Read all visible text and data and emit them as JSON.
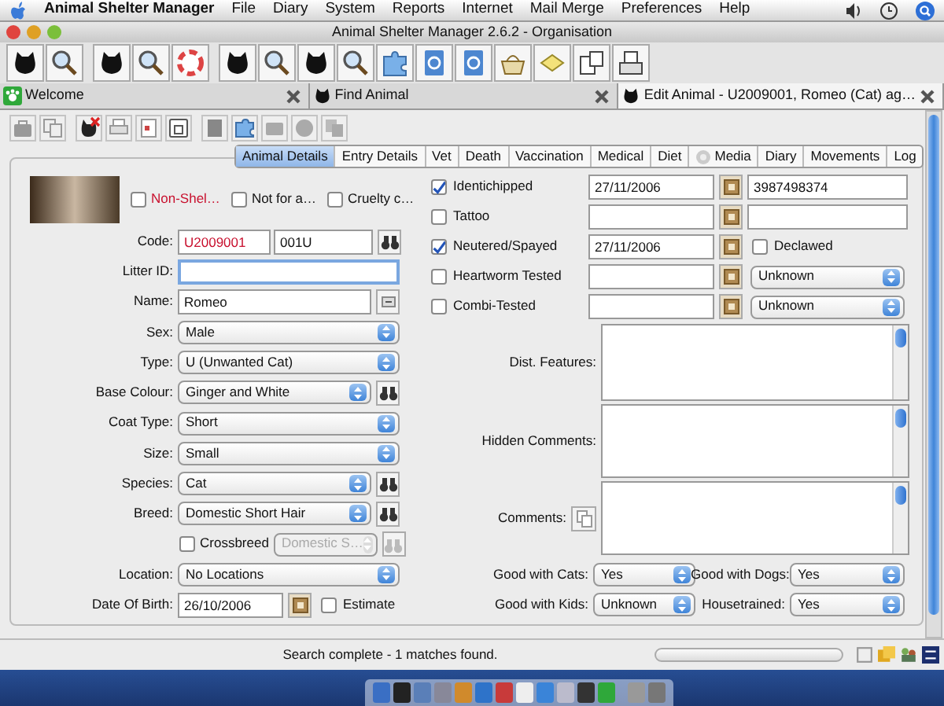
{
  "menu_bar": {
    "app_name": "Animal Shelter Manager",
    "items": [
      "File",
      "Diary",
      "System",
      "Reports",
      "Internet",
      "Mail Merge",
      "Preferences",
      "Help"
    ]
  },
  "window": {
    "title": "Animal Shelter Manager 2.6.2 - Organisation"
  },
  "doc_tabs": [
    {
      "label": "Welcome",
      "selected": false,
      "kind": "paw"
    },
    {
      "label": "Find Animal",
      "selected": false,
      "kind": "cat"
    },
    {
      "label": "Edit Animal - U2009001, Romeo (Cat) ag…",
      "selected": true,
      "kind": "cat"
    }
  ],
  "section_tabs": [
    {
      "label": "Animal Details",
      "selected": true,
      "kind": "plain"
    },
    {
      "label": "Entry Details",
      "selected": false,
      "kind": "plain"
    },
    {
      "label": "Vet",
      "selected": false,
      "kind": "plain"
    },
    {
      "label": "Death",
      "selected": false,
      "kind": "plain"
    },
    {
      "label": "Vaccination",
      "selected": false,
      "kind": "plain"
    },
    {
      "label": "Medical",
      "selected": false,
      "kind": "plain"
    },
    {
      "label": "Diet",
      "selected": false,
      "kind": "plain"
    },
    {
      "label": "Media",
      "selected": false,
      "kind": "icon"
    },
    {
      "label": "Diary",
      "selected": false,
      "kind": "plain"
    },
    {
      "label": "Movements",
      "selected": false,
      "kind": "plain"
    },
    {
      "label": "Log",
      "selected": false,
      "kind": "plain"
    }
  ],
  "flags": [
    {
      "label": "Non-Shel…",
      "checked": false,
      "warning": true
    },
    {
      "label": "Not for a…",
      "checked": false,
      "warning": false
    },
    {
      "label": "Cruelty c…",
      "checked": false,
      "warning": false
    }
  ],
  "fields_left": [
    {
      "kind": "code",
      "label": "Code:",
      "values": [
        "U2009001",
        "001U"
      ],
      "warning": true
    },
    {
      "kind": "text",
      "label": "Litter ID:",
      "focused": true
    },
    {
      "kind": "text_button",
      "label": "Name:",
      "value": "Romeo"
    },
    {
      "kind": "select",
      "label": "Sex:",
      "value": "Male"
    },
    {
      "kind": "select",
      "label": "Type:",
      "value": "U (Unwanted Cat)"
    },
    {
      "kind": "select_search",
      "label": "Base Colour:",
      "value": "Ginger and White"
    },
    {
      "kind": "select",
      "label": "Coat Type:",
      "value": "Short"
    },
    {
      "kind": "select",
      "label": "Size:",
      "value": "Small"
    },
    {
      "kind": "select_search",
      "label": "Species:",
      "value": "Cat"
    },
    {
      "kind": "select_search",
      "label": "Breed:",
      "value": "Domestic Short Hair"
    },
    {
      "kind": "crossbreed",
      "label": "Crossbreed",
      "checked": false,
      "value": "Domestic S…",
      "disabled": true
    },
    {
      "kind": "select",
      "label": "Location:",
      "value": "No Locations"
    },
    {
      "kind": "date",
      "label": "Date Of Birth:",
      "value": "26/10/2006",
      "estimate": {
        "label": "Estimate",
        "checked": false
      }
    }
  ],
  "checks_right": [
    {
      "label": "Identichipped",
      "checked": true,
      "date": "27/11/2006",
      "extra": {
        "kind": "text",
        "value": "3987498374"
      }
    },
    {
      "label": "Tattoo",
      "checked": false,
      "extra": {
        "kind": "text"
      }
    },
    {
      "label": "Neutered/Spayed",
      "checked": true,
      "date": "27/11/2006",
      "extra": {
        "kind": "checkbox",
        "label": "Declawed",
        "checked": false
      }
    },
    {
      "label": "Heartworm Tested",
      "checked": false,
      "extra": {
        "kind": "select",
        "value": "Unknown"
      }
    },
    {
      "label": "Combi-Tested",
      "checked": false,
      "extra": {
        "kind": "select",
        "value": "Unknown"
      }
    }
  ],
  "notes": [
    {
      "label": "Dist. Features:",
      "kind": "plain"
    },
    {
      "label": "Hidden Comments:",
      "kind": "plain"
    },
    {
      "label": "Comments:",
      "kind": "with_button"
    }
  ],
  "good_with": [
    {
      "label": "Good with Cats:",
      "value": "Yes"
    },
    {
      "label": "Good with Dogs:",
      "value": "Yes"
    },
    {
      "label": "Good with Kids:",
      "value": "Unknown"
    },
    {
      "label": "Housetrained:",
      "value": "Yes"
    }
  ],
  "status_bar": {
    "text": "Search complete - 1 matches found.",
    "level": 0
  }
}
